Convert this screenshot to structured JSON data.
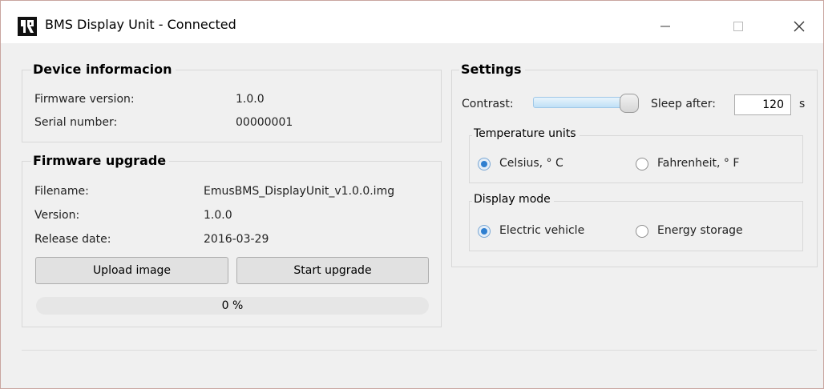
{
  "window": {
    "title": "BMS Display Unit - Connected",
    "controls": {
      "minimize": "—",
      "maximize": "☐",
      "close": "✕"
    }
  },
  "device_info": {
    "title": "Device informacion",
    "firmware_version_label": "Firmware version:",
    "firmware_version_value": "1.0.0",
    "serial_number_label": "Serial number:",
    "serial_number_value": "00000001"
  },
  "firmware_upgrade": {
    "title": "Firmware upgrade",
    "filename_label": "Filename:",
    "filename_value": "EmusBMS_DisplayUnit_v1.0.0.img",
    "version_label": "Version:",
    "version_value": "1.0.0",
    "release_date_label": "Release date:",
    "release_date_value": "2016-03-29",
    "upload_button": "Upload image",
    "start_button": "Start upgrade",
    "progress_percent": 0,
    "progress_text": "0 %"
  },
  "settings": {
    "title": "Settings",
    "contrast_label": "Contrast:",
    "contrast_level": 1.0,
    "sleep_label": "Sleep after:",
    "sleep_value": "120",
    "sleep_unit": "s",
    "temperature_units": {
      "title": "Temperature units",
      "options": [
        {
          "label": "Celsius, ° C",
          "checked": true
        },
        {
          "label": "Fahrenheit, ° F",
          "checked": false
        }
      ]
    },
    "display_mode": {
      "title": "Display mode",
      "options": [
        {
          "label": "Electric vehicle",
          "checked": true
        },
        {
          "label": "Energy storage",
          "checked": false
        }
      ]
    }
  }
}
